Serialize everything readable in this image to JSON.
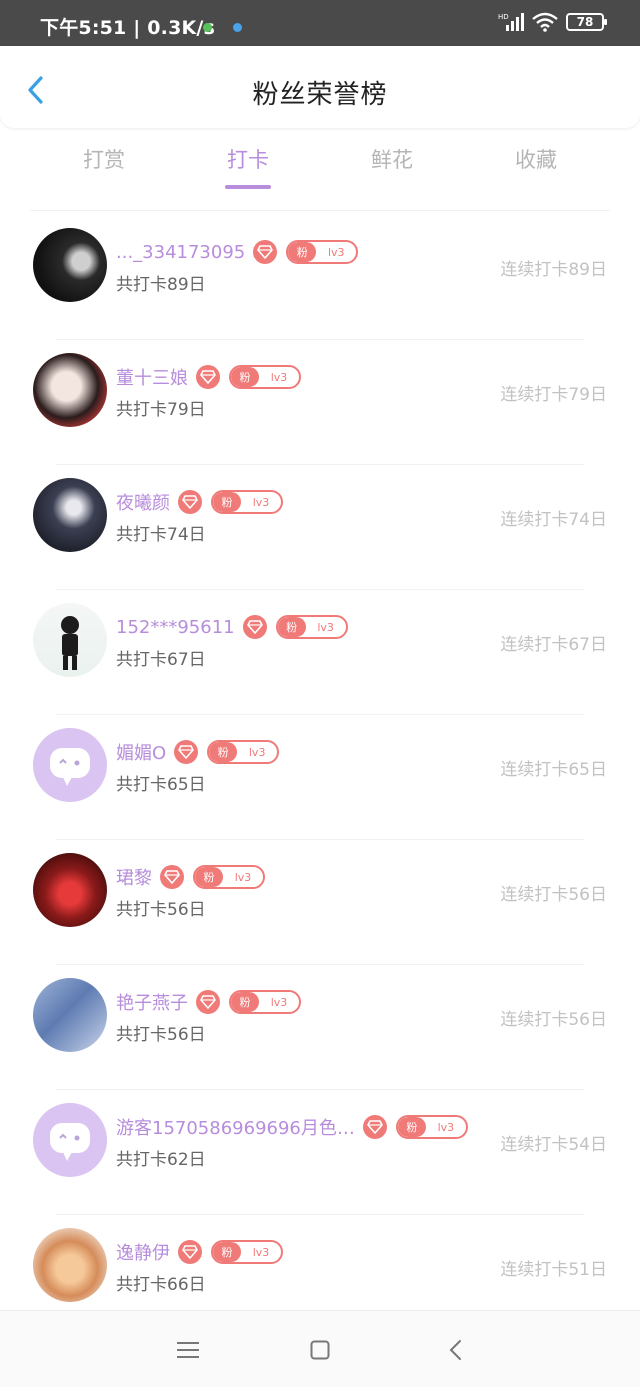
{
  "status_bar": {
    "left_text": "下午5:51 | 0.3K/s",
    "network_label": "HD",
    "battery": "78"
  },
  "header": {
    "title": "粉丝荣誉榜"
  },
  "tabs": [
    {
      "label": "打赏",
      "active": false
    },
    {
      "label": "打卡",
      "active": true
    },
    {
      "label": "鲜花",
      "active": false
    },
    {
      "label": "收藏",
      "active": false
    }
  ],
  "badge": {
    "fan_label": "粉",
    "level": "lv3"
  },
  "rows": [
    {
      "name": "..._334173095",
      "total": "共打卡89日",
      "streak": "连续打卡89日",
      "avatar": "photo-dark"
    },
    {
      "name": "董十三娘",
      "total": "共打卡79日",
      "streak": "连续打卡79日",
      "avatar": "photo-red-lips"
    },
    {
      "name": "夜曦颜",
      "total": "共打卡74日",
      "streak": "连续打卡74日",
      "avatar": "photo-night"
    },
    {
      "name": "152***95611",
      "total": "共打卡67日",
      "streak": "连续打卡67日",
      "avatar": "cartoon-boy"
    },
    {
      "name": "媚媚O",
      "total": "共打卡65日",
      "streak": "连续打卡65日",
      "avatar": "default-chat"
    },
    {
      "name": "珺黎",
      "total": "共打卡56日",
      "streak": "连续打卡56日",
      "avatar": "photo-rose"
    },
    {
      "name": "艳子燕子",
      "total": "共打卡56日",
      "streak": "连续打卡56日",
      "avatar": "photo-blue"
    },
    {
      "name": "游客1570586969696月色…",
      "total": "共打卡62日",
      "streak": "连续打卡54日",
      "avatar": "default-chat"
    },
    {
      "name": "逸静伊",
      "total": "共打卡66日",
      "streak": "连续打卡51日",
      "avatar": "photo-cat"
    }
  ],
  "colors": {
    "accent": "#b78ddc",
    "badge": "#f07a78",
    "muted": "#c2c2c2"
  }
}
